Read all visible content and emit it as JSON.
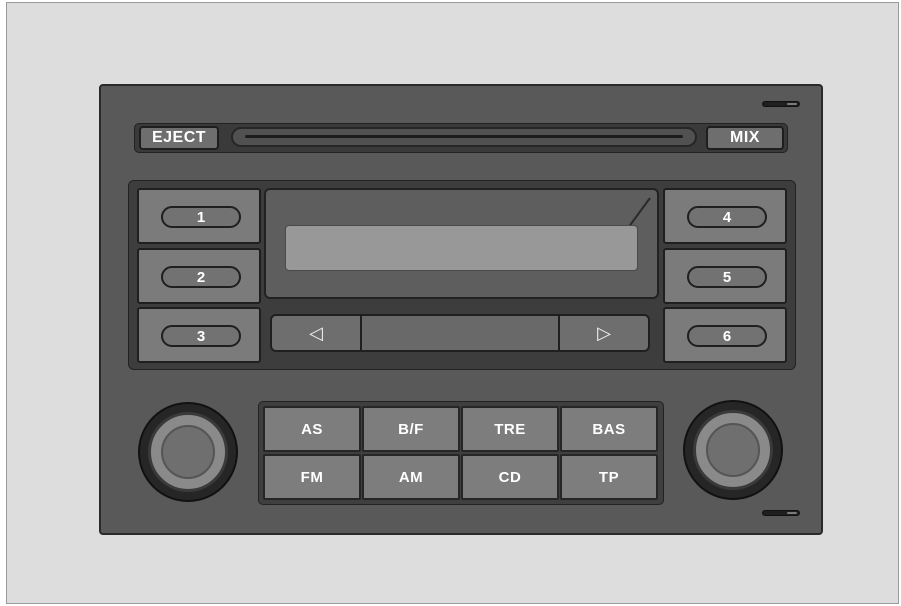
{
  "top_controls": {
    "eject_label": "EJECT",
    "mix_label": "MIX"
  },
  "presets": [
    {
      "label": "1"
    },
    {
      "label": "2"
    },
    {
      "label": "3"
    },
    {
      "label": "4"
    },
    {
      "label": "5"
    },
    {
      "label": "6"
    }
  ],
  "navigation": {
    "prev_symbol": "◁",
    "next_symbol": "▷"
  },
  "functions": [
    {
      "label": "AS"
    },
    {
      "label": "B/F"
    },
    {
      "label": "TRE"
    },
    {
      "label": "BAS"
    },
    {
      "label": "FM"
    },
    {
      "label": "AM"
    },
    {
      "label": "CD"
    },
    {
      "label": "TP"
    }
  ],
  "colors": {
    "faceplate": "#595959",
    "button": "#7b7b7b",
    "display": "#989898",
    "label": "#ffffff"
  }
}
